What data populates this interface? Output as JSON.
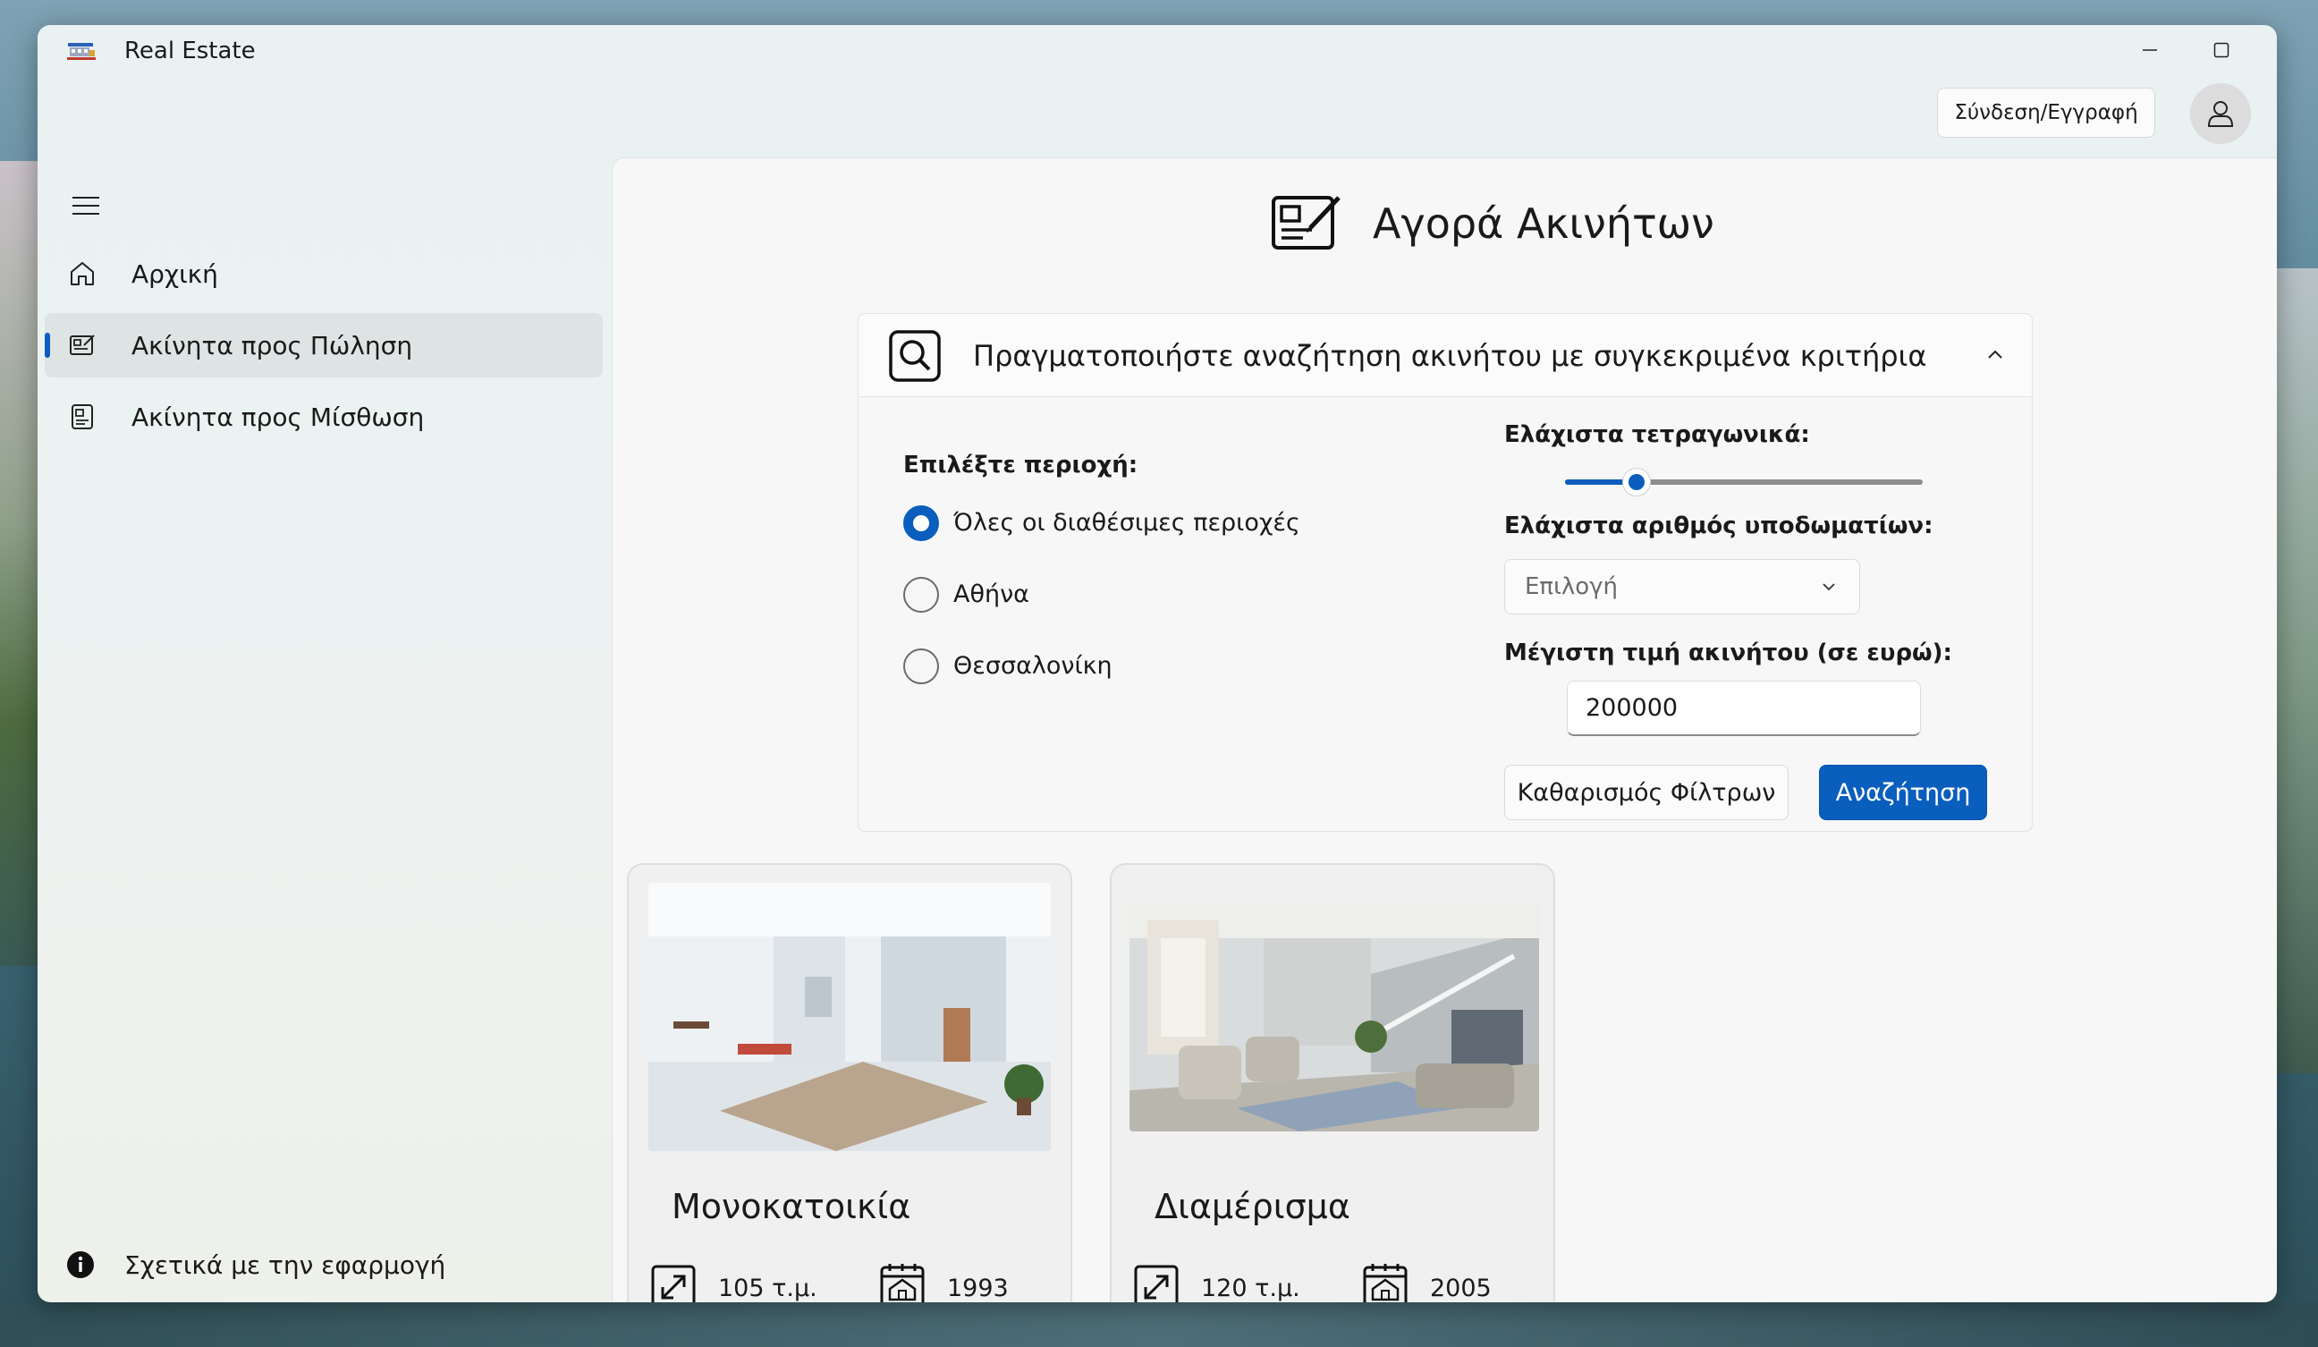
{
  "window": {
    "title": "Real Estate"
  },
  "header": {
    "login_label": "Σύνδεση/Εγγραφή"
  },
  "sidebar": {
    "items": [
      {
        "label": "Αρχική",
        "icon": "home-icon"
      },
      {
        "label": "Ακίνητα προς Πώληση",
        "icon": "property-sale-icon",
        "active": true
      },
      {
        "label": "Ακίνητα προς Μίσθωση",
        "icon": "property-rent-icon"
      }
    ],
    "about_label": "Σχετικά με την εφαρμογή"
  },
  "page": {
    "title": "Αγορά Ακινήτων"
  },
  "search": {
    "header": "Πραγματοποιήστε αναζήτηση ακινήτου με συγκεκριμένα κριτήρια",
    "area_label": "Επιλέξτε περιοχή:",
    "areas": [
      {
        "label": "Όλες οι διαθέσιμες περιοχές",
        "selected": true
      },
      {
        "label": "Αθήνα",
        "selected": false
      },
      {
        "label": "Θεσσαλονίκη",
        "selected": false
      }
    ],
    "min_sqm_label": "Ελάχιστα τετραγωνικά:",
    "min_sqm_slider_fraction": 0.2,
    "min_rooms_label": "Ελάχιστα αριθμός υποδωματίων:",
    "min_rooms_placeholder": "Επιλογή",
    "max_price_label": "Μέγιστη τιμή ακινήτου (σε ευρώ):",
    "max_price_value": "200000",
    "clear_label": "Καθαρισμός Φίλτρων",
    "search_label": "Αναζήτηση"
  },
  "listings": [
    {
      "title": "Μονοκατοικία",
      "area": "105 τ.μ.",
      "year": "1993"
    },
    {
      "title": "Διαμέρισμα",
      "area": "120 τ.μ.",
      "year": "2005"
    }
  ],
  "colors": {
    "accent": "#0a5ebd"
  }
}
